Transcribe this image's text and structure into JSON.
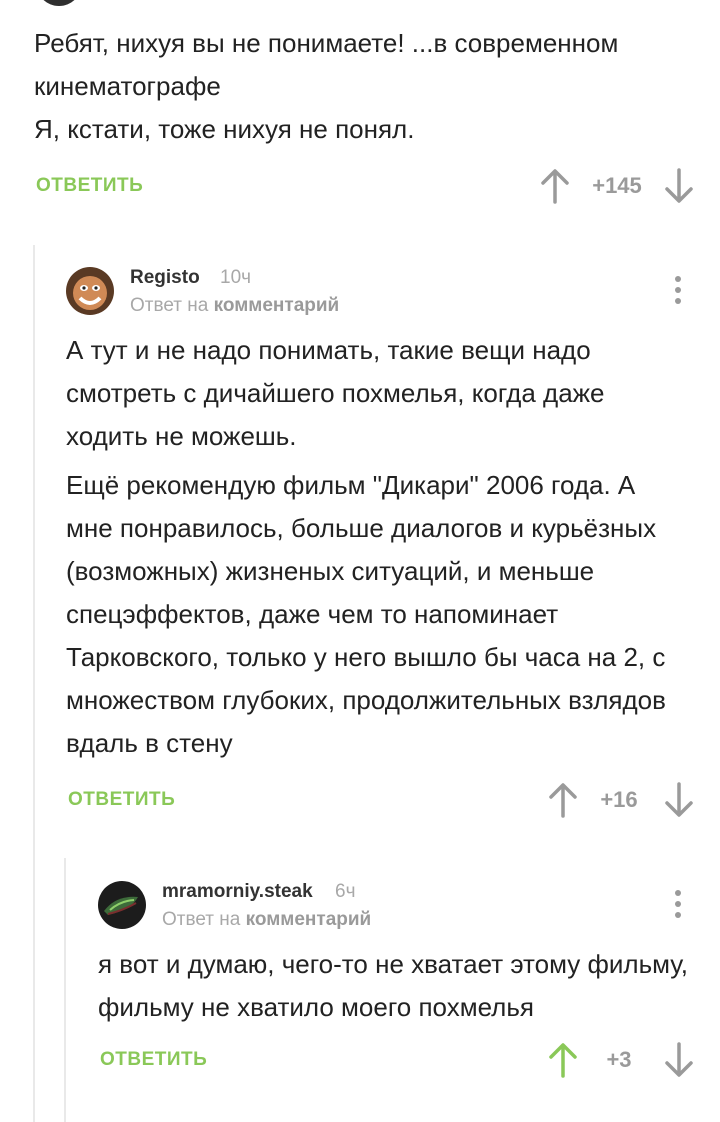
{
  "comment1": {
    "lines": [
      "Ребят, нихуя вы не понимаете! ...в современном кинематографе",
      "Я, кстати, тоже нихуя не понял."
    ],
    "reply_label": "ОТВЕТИТЬ",
    "score": "+145"
  },
  "comment2": {
    "username": "Registo",
    "time": "10ч",
    "reply_to_prefix": "Ответ на",
    "reply_to_link": "комментарий",
    "paragraphs": [
      "А тут и не надо понимать, такие вещи надо смотреть с дичайшего похмелья, когда даже ходить не можешь.",
      "Ещё рекомендую фильм \"Дикари\" 2006 года. А мне понравилось, больше диалогов и курьёзных (возможных) жизненых ситуаций, и меньше спецэффектов, даже чем то напоминает Тарковского, только у него вышло бы часа на 2, с множеством глубоких, продолжительных взлядов вдаль в стену"
    ],
    "reply_label": "ОТВЕТИТЬ",
    "score": "+16"
  },
  "comment3": {
    "username": "mramorniy.steak",
    "time": "6ч",
    "reply_to_prefix": "Ответ на",
    "reply_to_link": "комментарий",
    "paragraphs": [
      "я вот и думаю, чего-то не хватает этому фильму, фильму не хватило моего похмелья"
    ],
    "reply_label": "ОТВЕТИТЬ",
    "score": "+3",
    "upvoted": true
  },
  "colors": {
    "accent_green": "#8ac858",
    "meta_gray": "#a8a8a8",
    "arrow_gray": "#9a9a9a",
    "text": "#222222"
  },
  "icons": {
    "upvote": "arrow-up-icon",
    "downvote": "arrow-down-icon",
    "more": "more-vertical-icon"
  }
}
